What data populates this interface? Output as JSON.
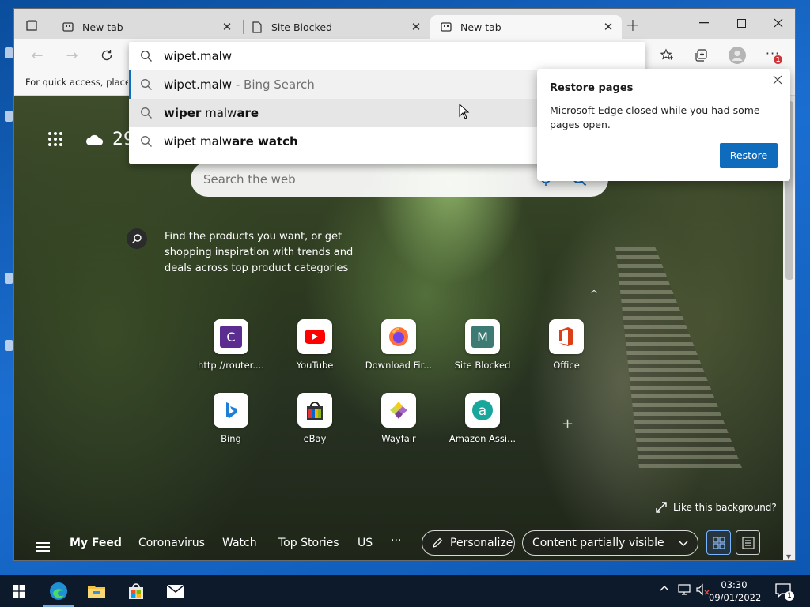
{
  "tabs": [
    {
      "title": "New tab",
      "active": false
    },
    {
      "title": "Site Blocked",
      "active": false
    },
    {
      "title": "New tab",
      "active": true
    }
  ],
  "favorites_bar": {
    "text": "For quick access, place your favorites here"
  },
  "address_bar": {
    "value": "wipet.malw",
    "suggestions": [
      {
        "main": "wipet.malw",
        "suffix": " - Bing Search"
      },
      {
        "bold1": "wiper",
        "plain": " malw",
        "bold2": "are"
      },
      {
        "plain": "wipet malw",
        "bold": "are watch"
      }
    ]
  },
  "restore_flyout": {
    "title": "Restore pages",
    "message": "Microsoft Edge closed while you had some pages open.",
    "button": "Restore"
  },
  "weather": {
    "temp": "29"
  },
  "search": {
    "placeholder": "Search the web"
  },
  "promo": {
    "text": "Find the products you want, or get shopping inspiration with trends and deals across top product categories"
  },
  "tiles": [
    {
      "label": "http://router...."
    },
    {
      "label": "YouTube"
    },
    {
      "label": "Download Fir..."
    },
    {
      "label": "Site Blocked"
    },
    {
      "label": "Office"
    },
    {
      "label": "Bing"
    },
    {
      "label": "eBay"
    },
    {
      "label": "Wayfair"
    },
    {
      "label": "Amazon Assi..."
    }
  ],
  "background": {
    "like_text": "Like this background?"
  },
  "feed": {
    "items": [
      "My Feed",
      "Coronavirus",
      "Watch",
      "Top Stories",
      "US"
    ],
    "more": "···",
    "personalize": "Personalize",
    "content_select": "Content partially visible"
  },
  "notifications": {
    "count": "1"
  },
  "taskbar": {
    "time": "03:30",
    "date": "09/01/2022"
  }
}
